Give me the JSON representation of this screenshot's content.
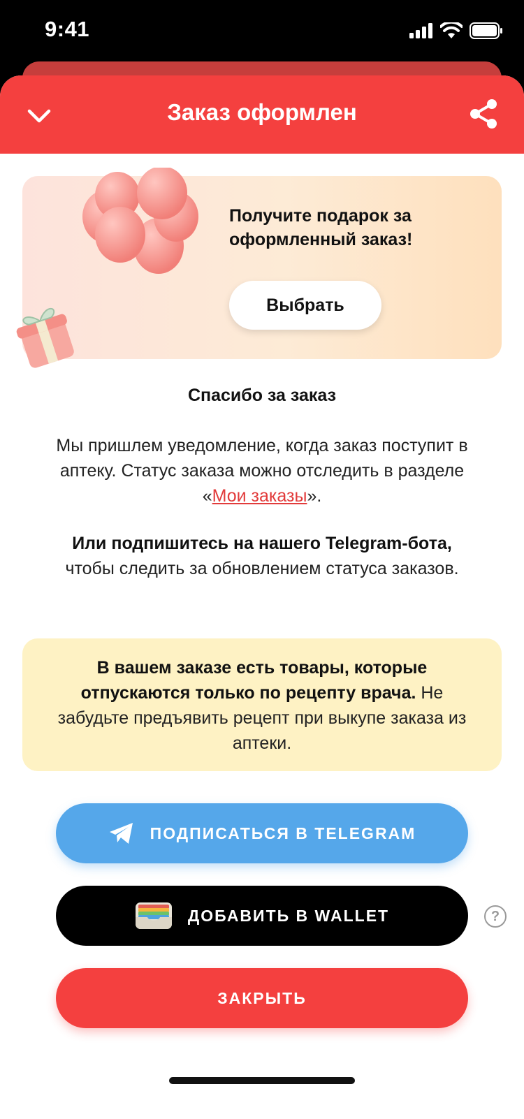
{
  "status_bar": {
    "time": "9:41"
  },
  "header": {
    "title": "Заказ оформлен"
  },
  "promo": {
    "title": "Получите подарок за оформленный заказ!",
    "button_label": "Выбрать"
  },
  "thanks": "Спасибо за заказ",
  "paragraph1": {
    "text_before": "Мы пришлем уведомление, когда заказ поступит в аптеку. Статус заказа можно отследить в разделе «",
    "link": "Мои заказы",
    "text_after": "»."
  },
  "paragraph2": {
    "bold": "Или подпишитесь на нашего Telegram-бота,",
    "rest": " чтобы следить за обновлением статуса заказов."
  },
  "warning": {
    "bold": "В вашем заказе есть товары, которые отпускаются только по рецепту врача.",
    "rest": " Не забудьте предъявить рецепт при выкупе заказа из аптеки."
  },
  "buttons": {
    "telegram": "ПОДПИСАТЬСЯ В TELEGRAM",
    "wallet": "ДОБАВИТЬ В WALLET",
    "close": "ЗАКРЫТЬ"
  },
  "help": "?",
  "colors": {
    "brand_red": "#f4403f",
    "telegram_blue": "#55a7ea",
    "warning_bg": "#fef2c4",
    "link": "#e23b3b"
  }
}
